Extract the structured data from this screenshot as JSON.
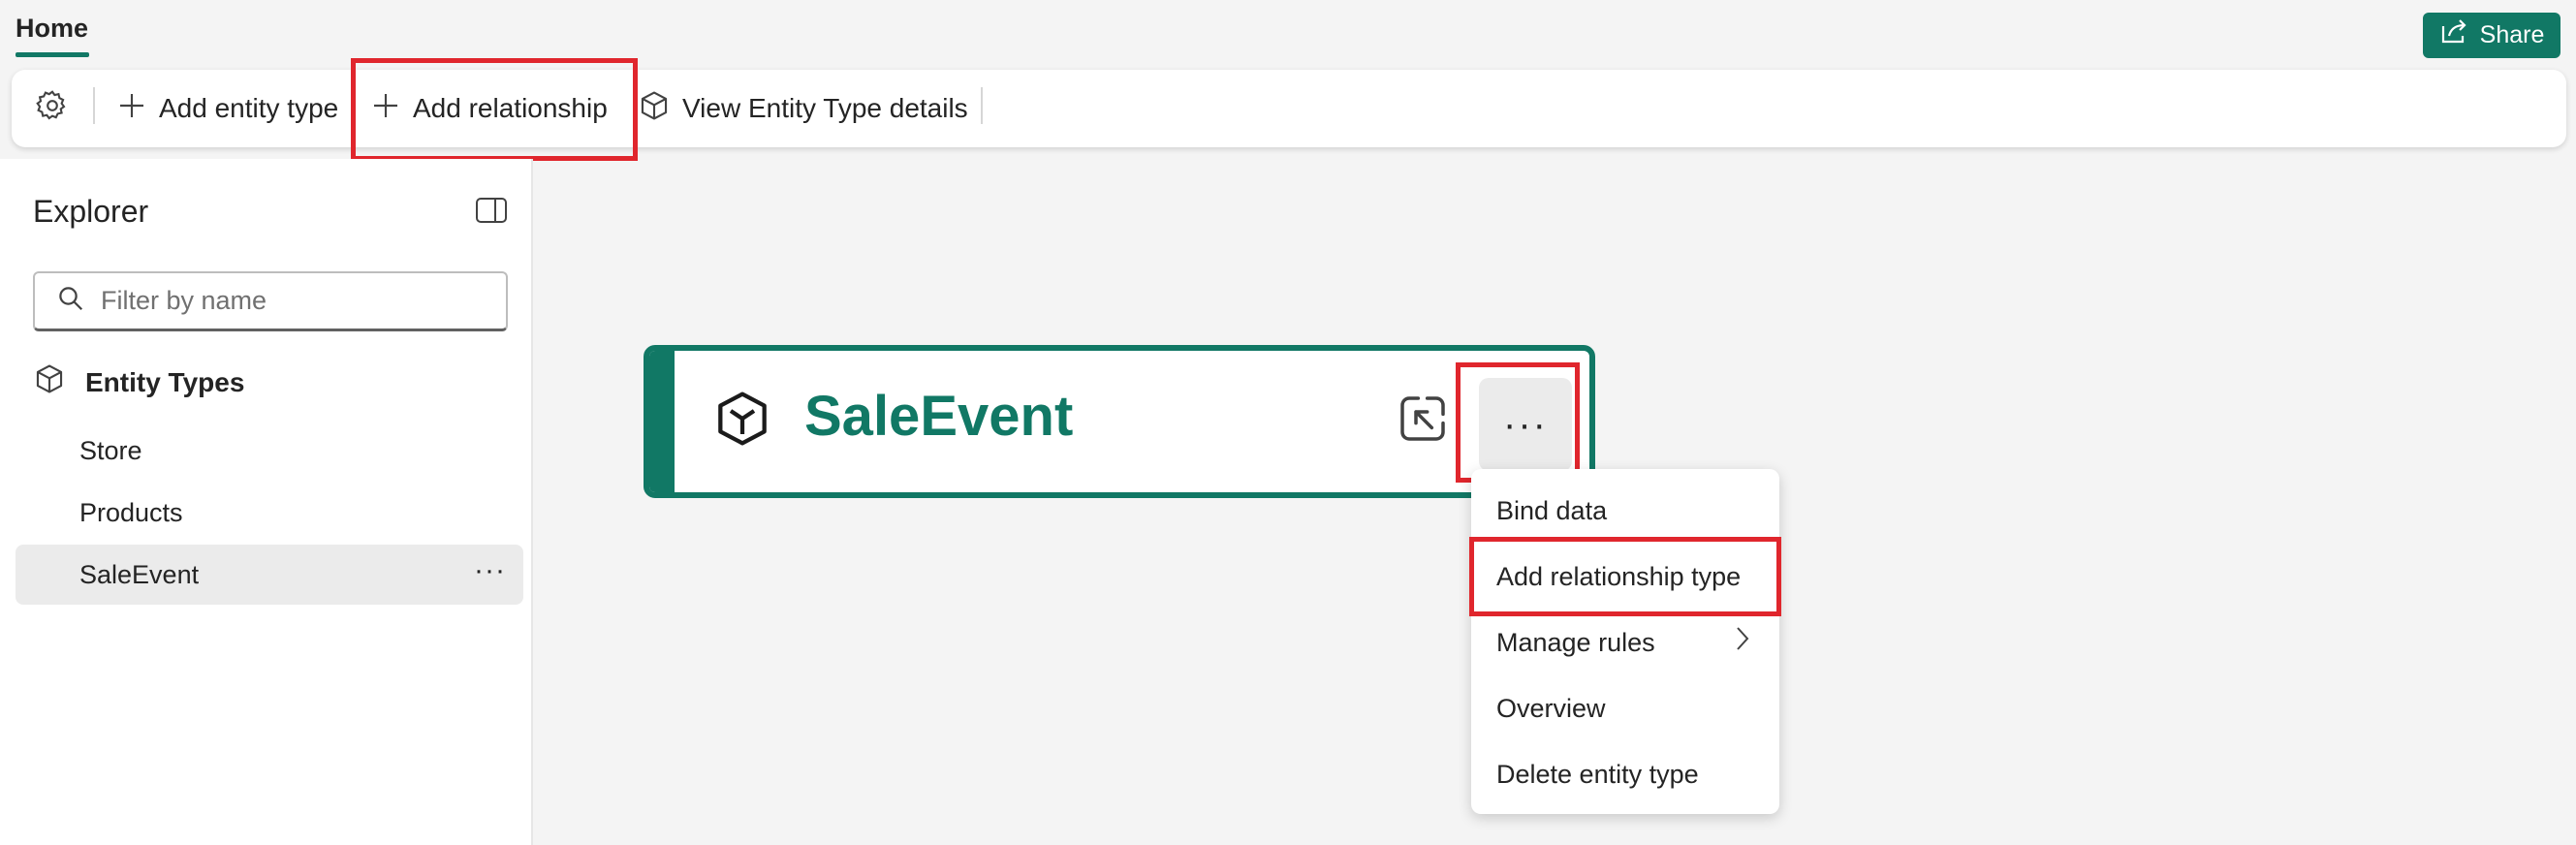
{
  "tabs": {
    "home": "Home"
  },
  "share": {
    "label": "Share"
  },
  "toolbar": {
    "add_entity_type": "Add entity type",
    "add_relationship": "Add relationship",
    "view_entity_type_details": "View Entity Type details"
  },
  "explorer": {
    "title": "Explorer",
    "filter_placeholder": "Filter by name",
    "section_label": "Entity Types",
    "items": [
      {
        "label": "Store"
      },
      {
        "label": "Products"
      },
      {
        "label": "SaleEvent"
      }
    ],
    "more": "···"
  },
  "card": {
    "title": "SaleEvent",
    "more": "···"
  },
  "context_menu": {
    "items": [
      {
        "label": "Bind data"
      },
      {
        "label": "Add relationship type"
      },
      {
        "label": "Manage rules"
      },
      {
        "label": "Overview"
      },
      {
        "label": "Delete entity type"
      }
    ]
  },
  "colors": {
    "accent": "#117865",
    "highlight": "#e0262d"
  }
}
